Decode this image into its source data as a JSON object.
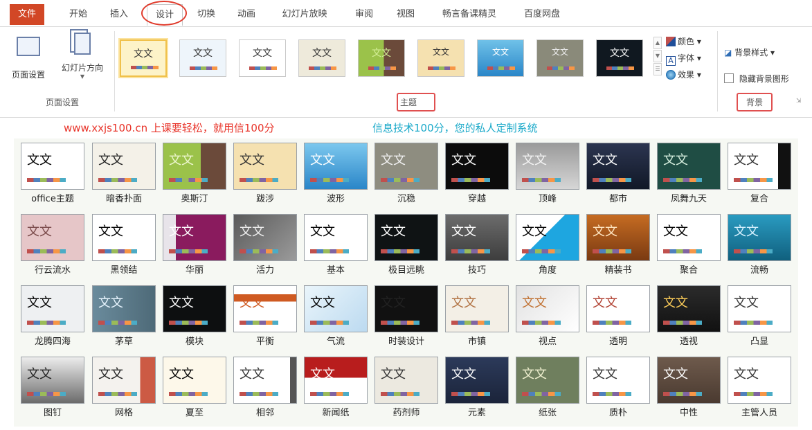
{
  "tabs": [
    "文件",
    "开始",
    "插入",
    "设计",
    "切换",
    "动画",
    "幻灯片放映",
    "审阅",
    "视图",
    "畅言备课精灵",
    "百度网盘"
  ],
  "active_tab": "设计",
  "page_setup": {
    "btn_page_setup": "页面设置",
    "btn_orientation": "幻灯片方向",
    "group_label": "页面设置"
  },
  "theme_group": {
    "label": "主题",
    "thumb_text": [
      "文文",
      "文文",
      "文文",
      "文文",
      "文文",
      "文文",
      "文文",
      "文文",
      "文文",
      "文文"
    ]
  },
  "theme_options": {
    "colors": "颜色",
    "fonts": "字体",
    "effects": "效果"
  },
  "background": {
    "styles": "背景样式",
    "hide_graphics": "隐藏背景图形",
    "group_label": "背景"
  },
  "banner": {
    "left": "www.xxjs100.cn  上课要轻松，就用信100分",
    "right": "信息技术100分，您的私人定制系统"
  },
  "themes": [
    "office主题",
    "暗香扑面",
    "奥斯汀",
    "跋涉",
    "波形",
    "沉稳",
    "穿越",
    "顶峰",
    "都市",
    "凤舞九天",
    "复合",
    "行云流水",
    "黑领结",
    "华丽",
    "活力",
    "基本",
    "极目远眺",
    "技巧",
    "角度",
    "精装书",
    "聚合",
    "流畅",
    "龙腾四海",
    "茅草",
    "模块",
    "平衡",
    "气流",
    "时装设计",
    "市镇",
    "视点",
    "透明",
    "透视",
    "凸显",
    "图钉",
    "网格",
    "夏至",
    "相邻",
    "新闻纸",
    "药剂师",
    "元素",
    "纸张",
    "质朴",
    "中性",
    "主管人员"
  ],
  "theme_card_text": "文文"
}
